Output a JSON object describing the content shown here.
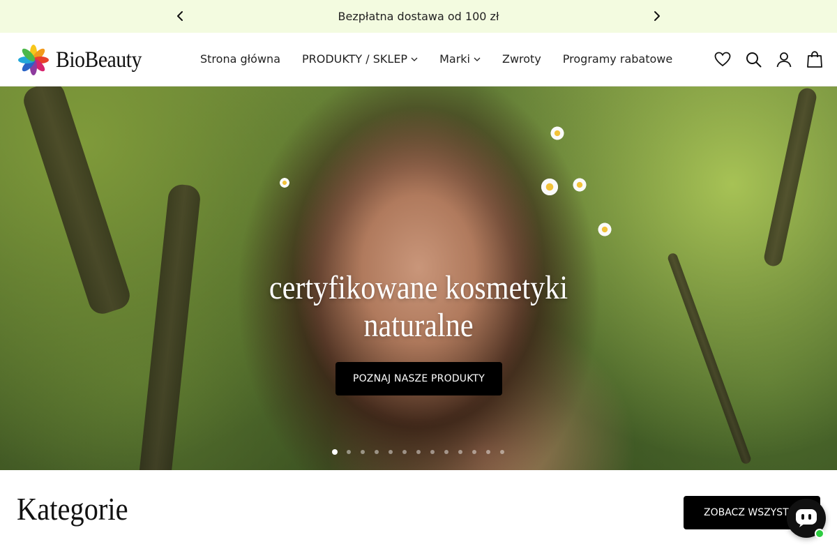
{
  "announcement": {
    "message": "Bezpłatna dostawa od 100 zł",
    "prev_icon": "chevron-left-icon",
    "next_icon": "chevron-right-icon"
  },
  "header": {
    "brand": "BioBeauty",
    "nav": [
      {
        "label": "Strona główna",
        "has_dropdown": false
      },
      {
        "label": "PRODUKTY / SKLEP",
        "has_dropdown": true
      },
      {
        "label": "Marki",
        "has_dropdown": true
      },
      {
        "label": "Zwroty",
        "has_dropdown": false
      },
      {
        "label": "Programy rabatowe",
        "has_dropdown": false
      }
    ],
    "icons": [
      "heart-icon",
      "search-icon",
      "user-icon",
      "bag-icon"
    ]
  },
  "hero": {
    "title_line1": "certyfikowane kosmetyki",
    "title_line2": "naturalne",
    "cta_label": "POZNAJ NASZE PRODUKTY",
    "slide_count": 13,
    "active_slide": 1
  },
  "categories": {
    "title": "Kategorie",
    "see_all_label": "ZOBACZ WSZYSTKIE"
  },
  "colors": {
    "announcement_bg": "#f3fbe0",
    "button_bg": "#000000",
    "chat_status": "#2ecc40"
  }
}
